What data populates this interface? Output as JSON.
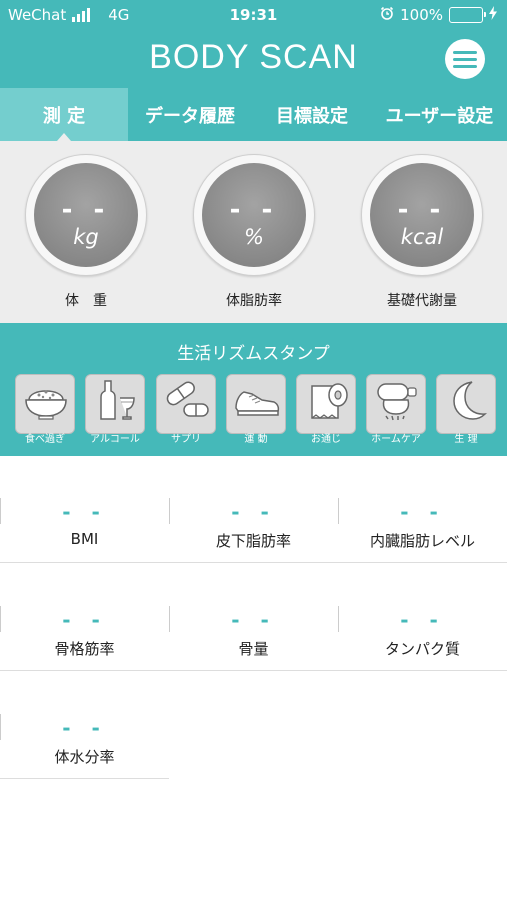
{
  "status_bar": {
    "carrier": "WeChat",
    "network": "4G",
    "time": "19:31",
    "battery": "100%",
    "battery_level": 1.0
  },
  "header": {
    "title": "BODY SCAN",
    "menu_icon": "hamburger-menu-icon"
  },
  "tabs": [
    {
      "label": "測 定",
      "active": true
    },
    {
      "label": "データ履歴",
      "active": false
    },
    {
      "label": "目標設定",
      "active": false
    },
    {
      "label": "ユーザー設定",
      "active": false
    }
  ],
  "gauges": [
    {
      "value": "- -",
      "unit": "kg",
      "label": "体　重"
    },
    {
      "value": "- -",
      "unit": "%",
      "label": "体脂肪率"
    },
    {
      "value": "- -",
      "unit": "kcal",
      "label": "基礎代謝量"
    }
  ],
  "stamps": {
    "title": "生活リズムスタンプ",
    "items": [
      {
        "label": "食べ過ぎ",
        "icon": "rice-bowl-icon"
      },
      {
        "label": "アルコール",
        "icon": "wine-bottle-icon"
      },
      {
        "label": "サプリ",
        "icon": "pill-icon"
      },
      {
        "label": "運 動",
        "icon": "sneaker-icon"
      },
      {
        "label": "お通じ",
        "icon": "toilet-paper-icon"
      },
      {
        "label": "ホームケア",
        "icon": "massager-icon"
      },
      {
        "label": "生 理",
        "icon": "crescent-moon-icon"
      }
    ]
  },
  "metrics": [
    {
      "value": "- -",
      "label": "BMI"
    },
    {
      "value": "- -",
      "label": "皮下脂肪率"
    },
    {
      "value": "- -",
      "label": "内臓脂肪レベル"
    },
    {
      "value": "- -",
      "label": "骨格筋率"
    },
    {
      "value": "- -",
      "label": "骨量"
    },
    {
      "value": "- -",
      "label": "タンパク質"
    },
    {
      "value": "- -",
      "label": "体水分率"
    }
  ],
  "colors": {
    "primary": "#45b9b9",
    "tab_active": "#74cece",
    "gauge_bg": "#ededed",
    "accent_value": "#45b9b9"
  }
}
